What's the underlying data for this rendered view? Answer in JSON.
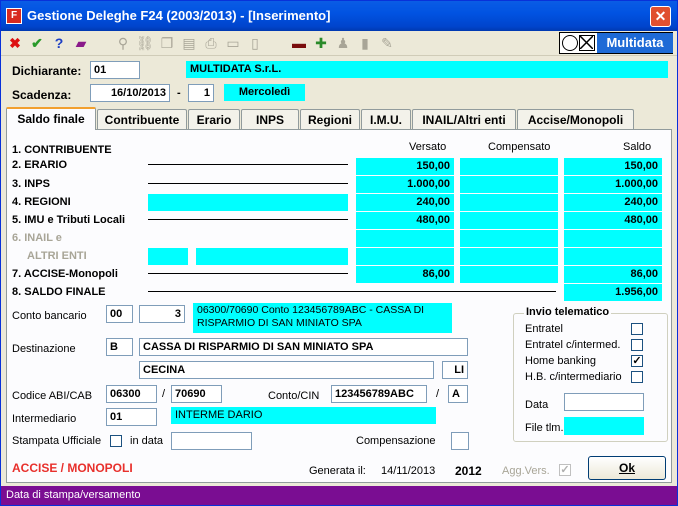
{
  "window": {
    "title": "Gestione Deleghe F24 (2003/2013) - [Inserimento]",
    "close_glyph": "✕"
  },
  "toolbar": {
    "icons": [
      "close-icon",
      "check-icon",
      "help-icon",
      "book-icon",
      "binoculars-icon",
      "link-icon",
      "copy-icon",
      "paste-icon",
      "print-icon",
      "export-icon",
      "f24-icon",
      "calendar-icon",
      "puzzle-icon",
      "user-icon",
      "save-icon",
      "pen-icon"
    ],
    "logo_text": "Multidata"
  },
  "header": {
    "dichiarante_label": "Dichiarante:",
    "dichiarante_code": "01",
    "dichiarante_name": "MULTIDATA S.r.L.",
    "scadenza_label": "Scadenza:",
    "scadenza_date": "16/10/2013",
    "scadenza_sep": "-",
    "scadenza_num": "1",
    "scadenza_day": "Mercoledì"
  },
  "tabs": [
    {
      "label": "Saldo finale",
      "active": true
    },
    {
      "label": "Contribuente",
      "active": false
    },
    {
      "label": "Erario",
      "active": false
    },
    {
      "label": "INPS",
      "active": false
    },
    {
      "label": "Regioni",
      "active": false
    },
    {
      "label": "I.M.U.",
      "active": false
    },
    {
      "label": "INAIL/Altri enti",
      "active": false
    },
    {
      "label": "Accise/Monopoli",
      "active": false
    }
  ],
  "summary": {
    "col_versato": "Versato",
    "col_compensato": "Compensato",
    "col_saldo": "Saldo",
    "rows": [
      {
        "label": "1. CONTRIBUENTE",
        "versato": "",
        "compensato": "",
        "saldo": ""
      },
      {
        "label": "2. ERARIO",
        "versato": "150,00",
        "compensato": "",
        "saldo": "150,00"
      },
      {
        "label": "3. INPS",
        "versato": "1.000,00",
        "compensato": "",
        "saldo": "1.000,00"
      },
      {
        "label": "4. REGIONI",
        "versato": "240,00",
        "compensato": "",
        "saldo": "240,00"
      },
      {
        "label": "5. IMU e Tributi Locali",
        "versato": "480,00",
        "compensato": "",
        "saldo": "480,00"
      },
      {
        "label": "6. INAIL e",
        "versato": "",
        "compensato": "",
        "saldo": ""
      },
      {
        "label": "ALTRI ENTI",
        "versato": "",
        "compensato": "",
        "saldo": ""
      },
      {
        "label": "7. ACCISE-Monopoli",
        "versato": "86,00",
        "compensato": "",
        "saldo": "86,00"
      },
      {
        "label": "8. SALDO FINALE",
        "versato": "",
        "compensato": "",
        "saldo": "1.956,00"
      }
    ]
  },
  "bank": {
    "conto_label": "Conto bancario",
    "conto_code": "00",
    "conto_num": "3",
    "conto_desc": "06300/70690 Conto 123456789ABC - CASSA DI RISPARMIO DI SAN MINIATO SPA",
    "destinazione_label": "Destinazione",
    "dest_code": "B",
    "dest_name": "CASSA DI RISPARMIO DI SAN MINIATO SPA",
    "dest_city": "CECINA",
    "dest_prov": "LI",
    "abi_label": "Codice ABI/CAB",
    "abi": "06300",
    "slash": "/",
    "cab": "70690",
    "conto_cin_label": "Conto/CIN",
    "conto": "123456789ABC",
    "cin": "A",
    "intermediario_label": "Intermediario",
    "intermediario_code": "01",
    "intermediario_name": "INTERME DARIO",
    "stampata_label": "Stampata Ufficiale",
    "in_data_label": "in data",
    "in_data_value": "",
    "compensazione_label": "Compensazione"
  },
  "invio": {
    "title": "Invio telematico",
    "options": [
      {
        "label": "Entratel",
        "checked": false
      },
      {
        "label": "Entratel c/intermed.",
        "checked": false
      },
      {
        "label": "Home banking",
        "checked": true
      },
      {
        "label": "H.B. c/intermediario",
        "checked": false
      }
    ],
    "data_label": "Data",
    "data_value": "",
    "file_label": "File tlm.",
    "file_value": ""
  },
  "footer": {
    "section_name": "ACCISE / MONOPOLI",
    "generata_label": "Generata il:",
    "generata_date": "14/11/2013",
    "year": "2012",
    "agg_vers_label": "Agg.Vers.",
    "ok_label": "Ok",
    "status_text": "Data di stampa/versamento"
  },
  "colors": {
    "cyan_field": "#00ffff",
    "title_blue": "#0153e2",
    "status_purple": "#7a0d92",
    "accent_red": "#e8302c"
  }
}
